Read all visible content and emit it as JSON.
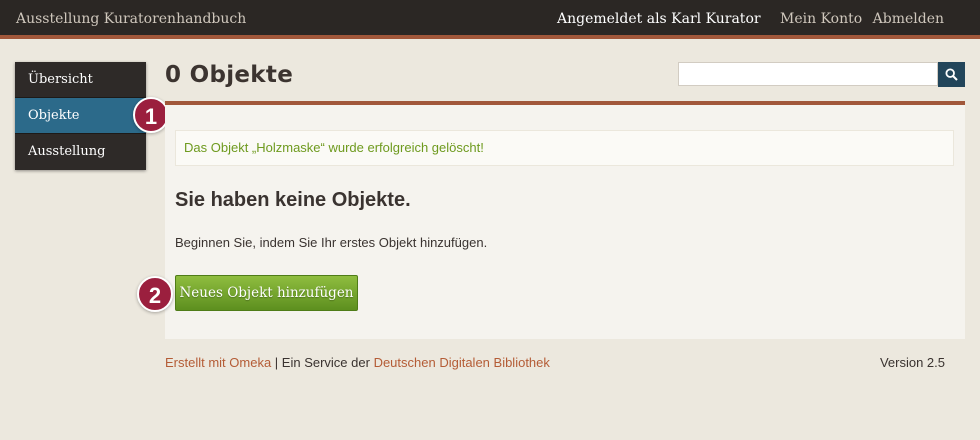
{
  "header": {
    "site_title": "Ausstellung Kuratorenhandbuch",
    "logged_in_label": "Angemeldet als Karl Kurator",
    "account_link": "Mein Konto",
    "logout_link": "Abmelden"
  },
  "sidebar": {
    "items": [
      {
        "label": "Übersicht",
        "active": false
      },
      {
        "label": "Objekte",
        "active": true
      },
      {
        "label": "Ausstellung",
        "active": false
      }
    ]
  },
  "main": {
    "title": "0 Objekte",
    "search": {
      "placeholder": "",
      "value": "",
      "button_icon": "search-icon"
    },
    "flash_message": "Das Objekt „Holzmaske“ wurde erfolgreich gelöscht!",
    "empty_heading": "Sie haben keine Objekte.",
    "empty_text": "Beginnen Sie, indem Sie Ihr erstes Objekt hinzufügen.",
    "add_button": "Neues Objekt hinzufügen"
  },
  "annotations": {
    "badge_1": "1",
    "badge_2": "2"
  },
  "footer": {
    "made_with_link": "Erstellt mit Omeka",
    "separator_text": " | Ein Service der ",
    "ddb_link": "Deutschen Digitalen Bibliothek",
    "version": "Version 2.5"
  },
  "colors": {
    "accent": "#a1573a",
    "nav_active": "#2c6a8a",
    "success_text": "#6e9a1e",
    "button_green": "#6fa22a",
    "badge": "#9b1f3e"
  }
}
